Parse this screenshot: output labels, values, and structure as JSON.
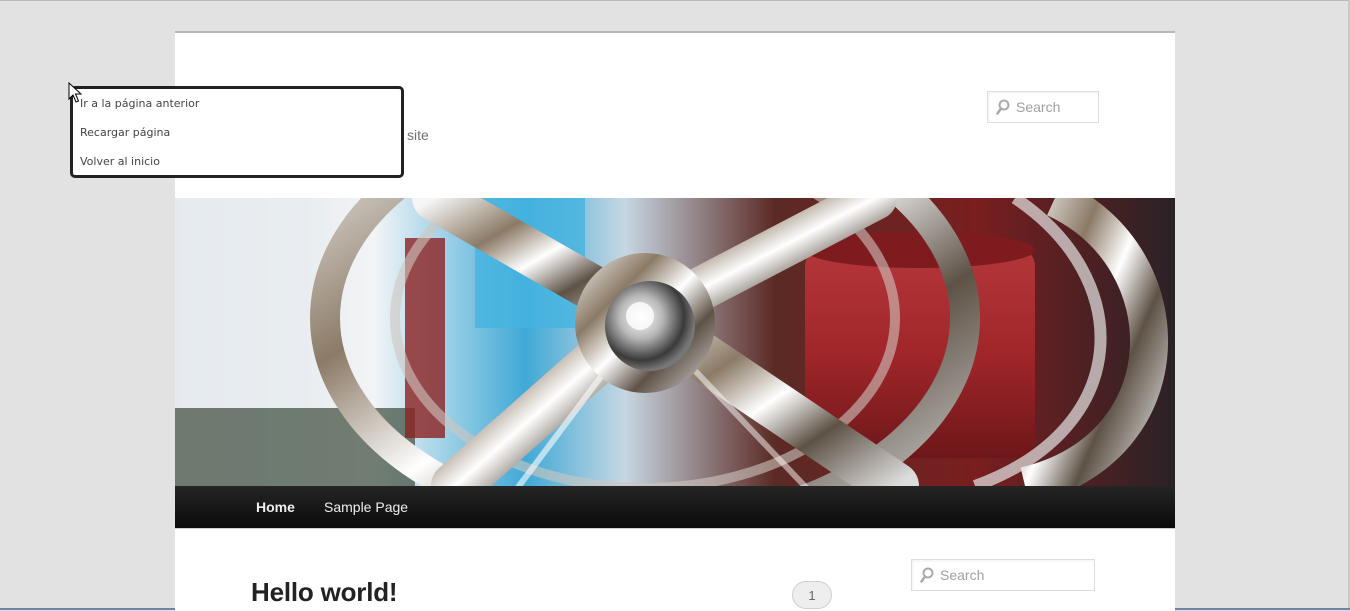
{
  "site": {
    "description_fragment": "site"
  },
  "search": {
    "header_placeholder": "Search",
    "sidebar_placeholder": "Search"
  },
  "nav": {
    "items": [
      {
        "label": "Home",
        "current": true
      },
      {
        "label": "Sample Page",
        "current": false
      }
    ]
  },
  "post": {
    "title": "Hello world!",
    "comment_count": "1"
  },
  "context_menu": {
    "items": [
      {
        "label": "Ir a la página anterior"
      },
      {
        "label": "Recargar página"
      },
      {
        "label": "Volver al inicio"
      }
    ]
  },
  "header_image": {
    "icon": "wheel-photo",
    "colors": {
      "chrome": "#d9d9d9",
      "red": "#a1262a",
      "blue": "#3fa9d6"
    }
  },
  "colors": {
    "background": "#e2e2e2",
    "nav_bar": "#111111",
    "menu_border": "#222222"
  }
}
